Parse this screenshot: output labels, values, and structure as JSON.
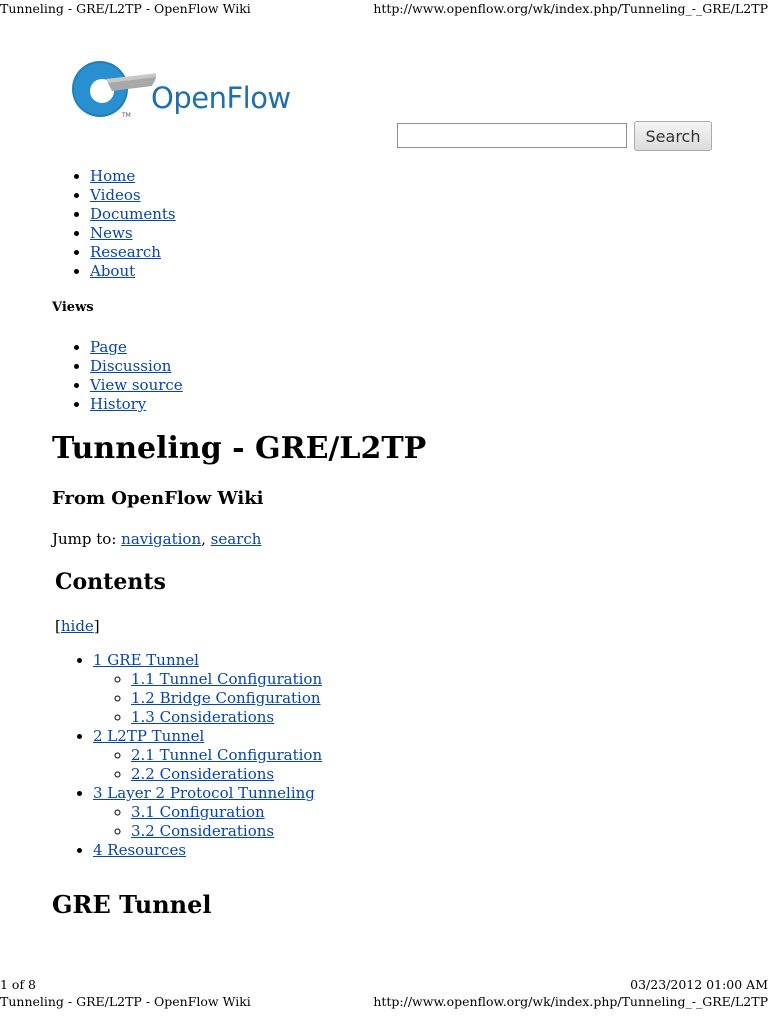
{
  "print_header": {
    "title": "Tunneling - GRE/L2TP - OpenFlow Wiki",
    "url": "http://www.openflow.org/wk/index.php/Tunneling_-_GRE/L2TP"
  },
  "logo": {
    "text": "OpenFlow",
    "tm": "TM"
  },
  "search": {
    "value": "",
    "button_label": "Search"
  },
  "nav": [
    "Home",
    "Videos",
    "Documents",
    "News",
    "Research",
    "About"
  ],
  "views": {
    "label": "Views",
    "items": [
      "Page",
      "Discussion",
      "View source",
      "History"
    ]
  },
  "page": {
    "title": "Tunneling - GRE/L2TP",
    "subtitle": "From OpenFlow Wiki",
    "jump_prefix": "Jump to:",
    "jump_links": [
      "navigation",
      "search"
    ],
    "jump_sep": ", "
  },
  "toc": {
    "title": "Contents",
    "hide_label": "hide",
    "items": [
      {
        "label": "1 GRE Tunnel",
        "children": [
          "1.1 Tunnel Configuration",
          "1.2 Bridge Configuration",
          "1.3 Considerations"
        ]
      },
      {
        "label": "2 L2TP Tunnel",
        "children": [
          "2.1 Tunnel Configuration",
          "2.2 Considerations"
        ]
      },
      {
        "label": "3 Layer 2 Protocol Tunneling",
        "children": [
          "3.1 Configuration",
          "3.2 Considerations"
        ]
      },
      {
        "label": "4 Resources",
        "children": []
      }
    ]
  },
  "section_heading": "GRE Tunnel",
  "footer": {
    "page_count": "1 of 8",
    "datetime": "03/23/2012 01:00 AM",
    "title": "Tunneling - GRE/L2TP - OpenFlow Wiki",
    "url": "http://www.openflow.org/wk/index.php/Tunneling_-_GRE/L2TP"
  },
  "colors": {
    "link": "#0645ad",
    "logo_blue": "#1f6fae"
  }
}
